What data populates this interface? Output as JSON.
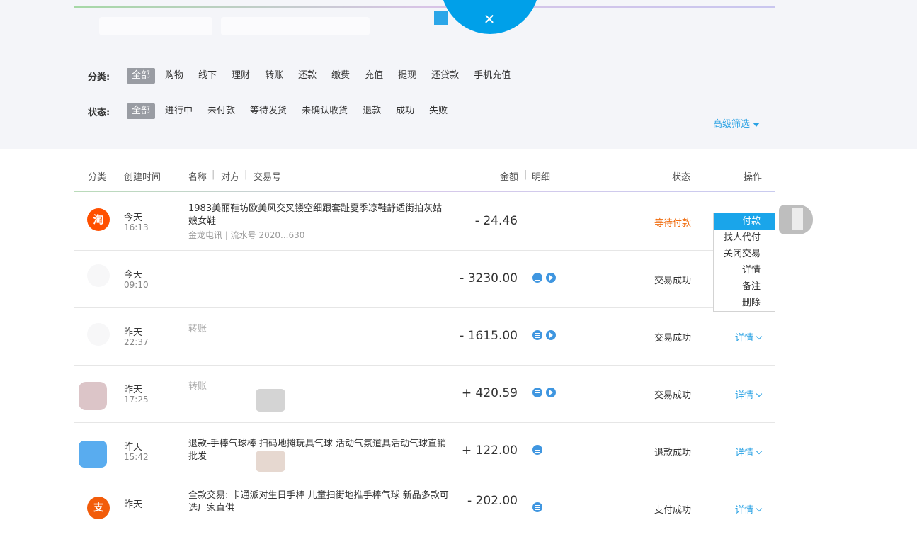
{
  "filters": {
    "category_label": "分类:",
    "categories": [
      "全部",
      "购物",
      "线下",
      "理财",
      "转账",
      "还款",
      "缴费",
      "充值",
      "提现",
      "还贷款",
      "手机充值"
    ],
    "status_label": "状态:",
    "statuses": [
      "全部",
      "进行中",
      "未付款",
      "等待发货",
      "未确认收货",
      "退款",
      "成功",
      "失败"
    ],
    "advanced": "高级筛选"
  },
  "table": {
    "headers": {
      "category": "分类",
      "created": "创建时间",
      "name": "名称",
      "counterparty": "对方",
      "txn_no": "交易号",
      "amount": "金额",
      "detail": "明细",
      "status": "状态",
      "action": "操作"
    },
    "rows": [
      {
        "day": "今天",
        "time": "16:13",
        "name": "1983美丽鞋坊欧美风交叉镂空细跟套趾夏季凉鞋舒适街拍灰姑娘女鞋",
        "sub": "金龙电讯 | 流水号 2020...630",
        "amount": "- 24.46",
        "status": "等待付款"
      },
      {
        "day": "今天",
        "time": "09:10",
        "name": "",
        "sub": "",
        "amount": "- 3230.00",
        "status": "交易成功"
      },
      {
        "day": "昨天",
        "time": "22:37",
        "name": "转账",
        "sub": "",
        "amount": "- 1615.00",
        "status": "交易成功",
        "action": "详情"
      },
      {
        "day": "昨天",
        "time": "17:25",
        "name": "转账",
        "sub": "",
        "amount": "+ 420.59",
        "status": "交易成功",
        "action": "详情"
      },
      {
        "day": "昨天",
        "time": "15:42",
        "name": "退款-手棒气球棒 扫码地摊玩具气球 活动气氛道具活动气球直销批发",
        "sub": "",
        "amount": "+ 122.00",
        "status": "退款成功",
        "action": "详情"
      },
      {
        "day": "昨天",
        "time": "",
        "name": "全款交易: 卡通派对生日手棒 儿童扫街地推手棒气球 新品多款可选厂家直供",
        "sub": "",
        "amount": "- 202.00",
        "status": "支付成功",
        "action": "详情"
      }
    ]
  },
  "action_menu": [
    "付款",
    "找人代付",
    "关闭交易",
    "详情",
    "备注",
    "删除"
  ],
  "icons": {
    "taobao": "淘",
    "alipay": "支"
  },
  "colors": {
    "accent": "#2aa2e4",
    "pending": "#f06d10",
    "taobao_orange": "#ff5000"
  }
}
